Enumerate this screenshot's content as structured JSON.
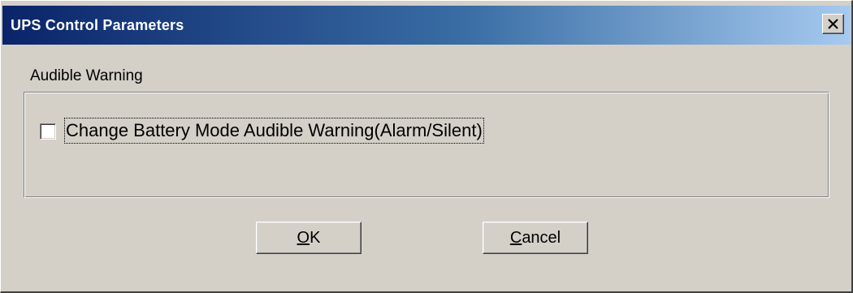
{
  "dialog": {
    "title": "UPS Control Parameters",
    "close_symbol": "close-icon"
  },
  "audible_warning": {
    "group_label": "Audible Warning",
    "checkbox_label": "Change Battery Mode Audible Warning(Alarm/Silent)",
    "checked": false
  },
  "buttons": {
    "ok_mnemonic": "O",
    "ok_rest": "K",
    "cancel_mnemonic": "C",
    "cancel_rest": "ancel"
  },
  "colors": {
    "title_gradient_start": "#0a246a",
    "title_gradient_end": "#a6caf0",
    "face": "#d4d0c8"
  }
}
